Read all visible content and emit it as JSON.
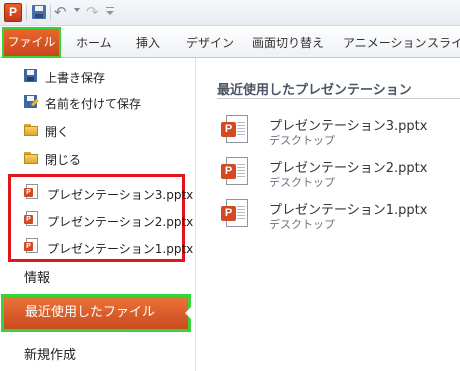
{
  "app": {
    "icon_letter": "P"
  },
  "qat": {
    "undo_glyph": "↶",
    "redo_glyph": "↷"
  },
  "ribbon": {
    "file_tab": "ファイル",
    "tabs": [
      "ホーム",
      "挿入",
      "デザイン",
      "画面切り替え",
      "アニメーション",
      "スライ"
    ]
  },
  "backstage": {
    "commands": [
      {
        "label": "上書き保存",
        "icon": "save-icon"
      },
      {
        "label": "名前を付けて保存",
        "icon": "save-as-icon"
      },
      {
        "label": "開く",
        "icon": "open-folder-icon"
      },
      {
        "label": "閉じる",
        "icon": "close-folder-icon"
      }
    ],
    "recent_files": [
      "プレゼンテーション3.pptx",
      "プレゼンテーション2.pptx",
      "プレゼンテーション1.pptx"
    ],
    "info": "情報",
    "recent": "最近使用したファイル",
    "new": "新規作成"
  },
  "main": {
    "title": "最近使用したプレゼンテーション",
    "presentations": [
      {
        "name": "プレゼンテーション3.pptx",
        "location": "デスクトップ"
      },
      {
        "name": "プレゼンテーション2.pptx",
        "location": "デスクトップ"
      },
      {
        "name": "プレゼンテーション1.pptx",
        "location": "デスクトップ"
      }
    ]
  },
  "colors": {
    "accent": "#d24a22",
    "highlight_green": "#35d535",
    "highlight_red": "#e0161c"
  }
}
